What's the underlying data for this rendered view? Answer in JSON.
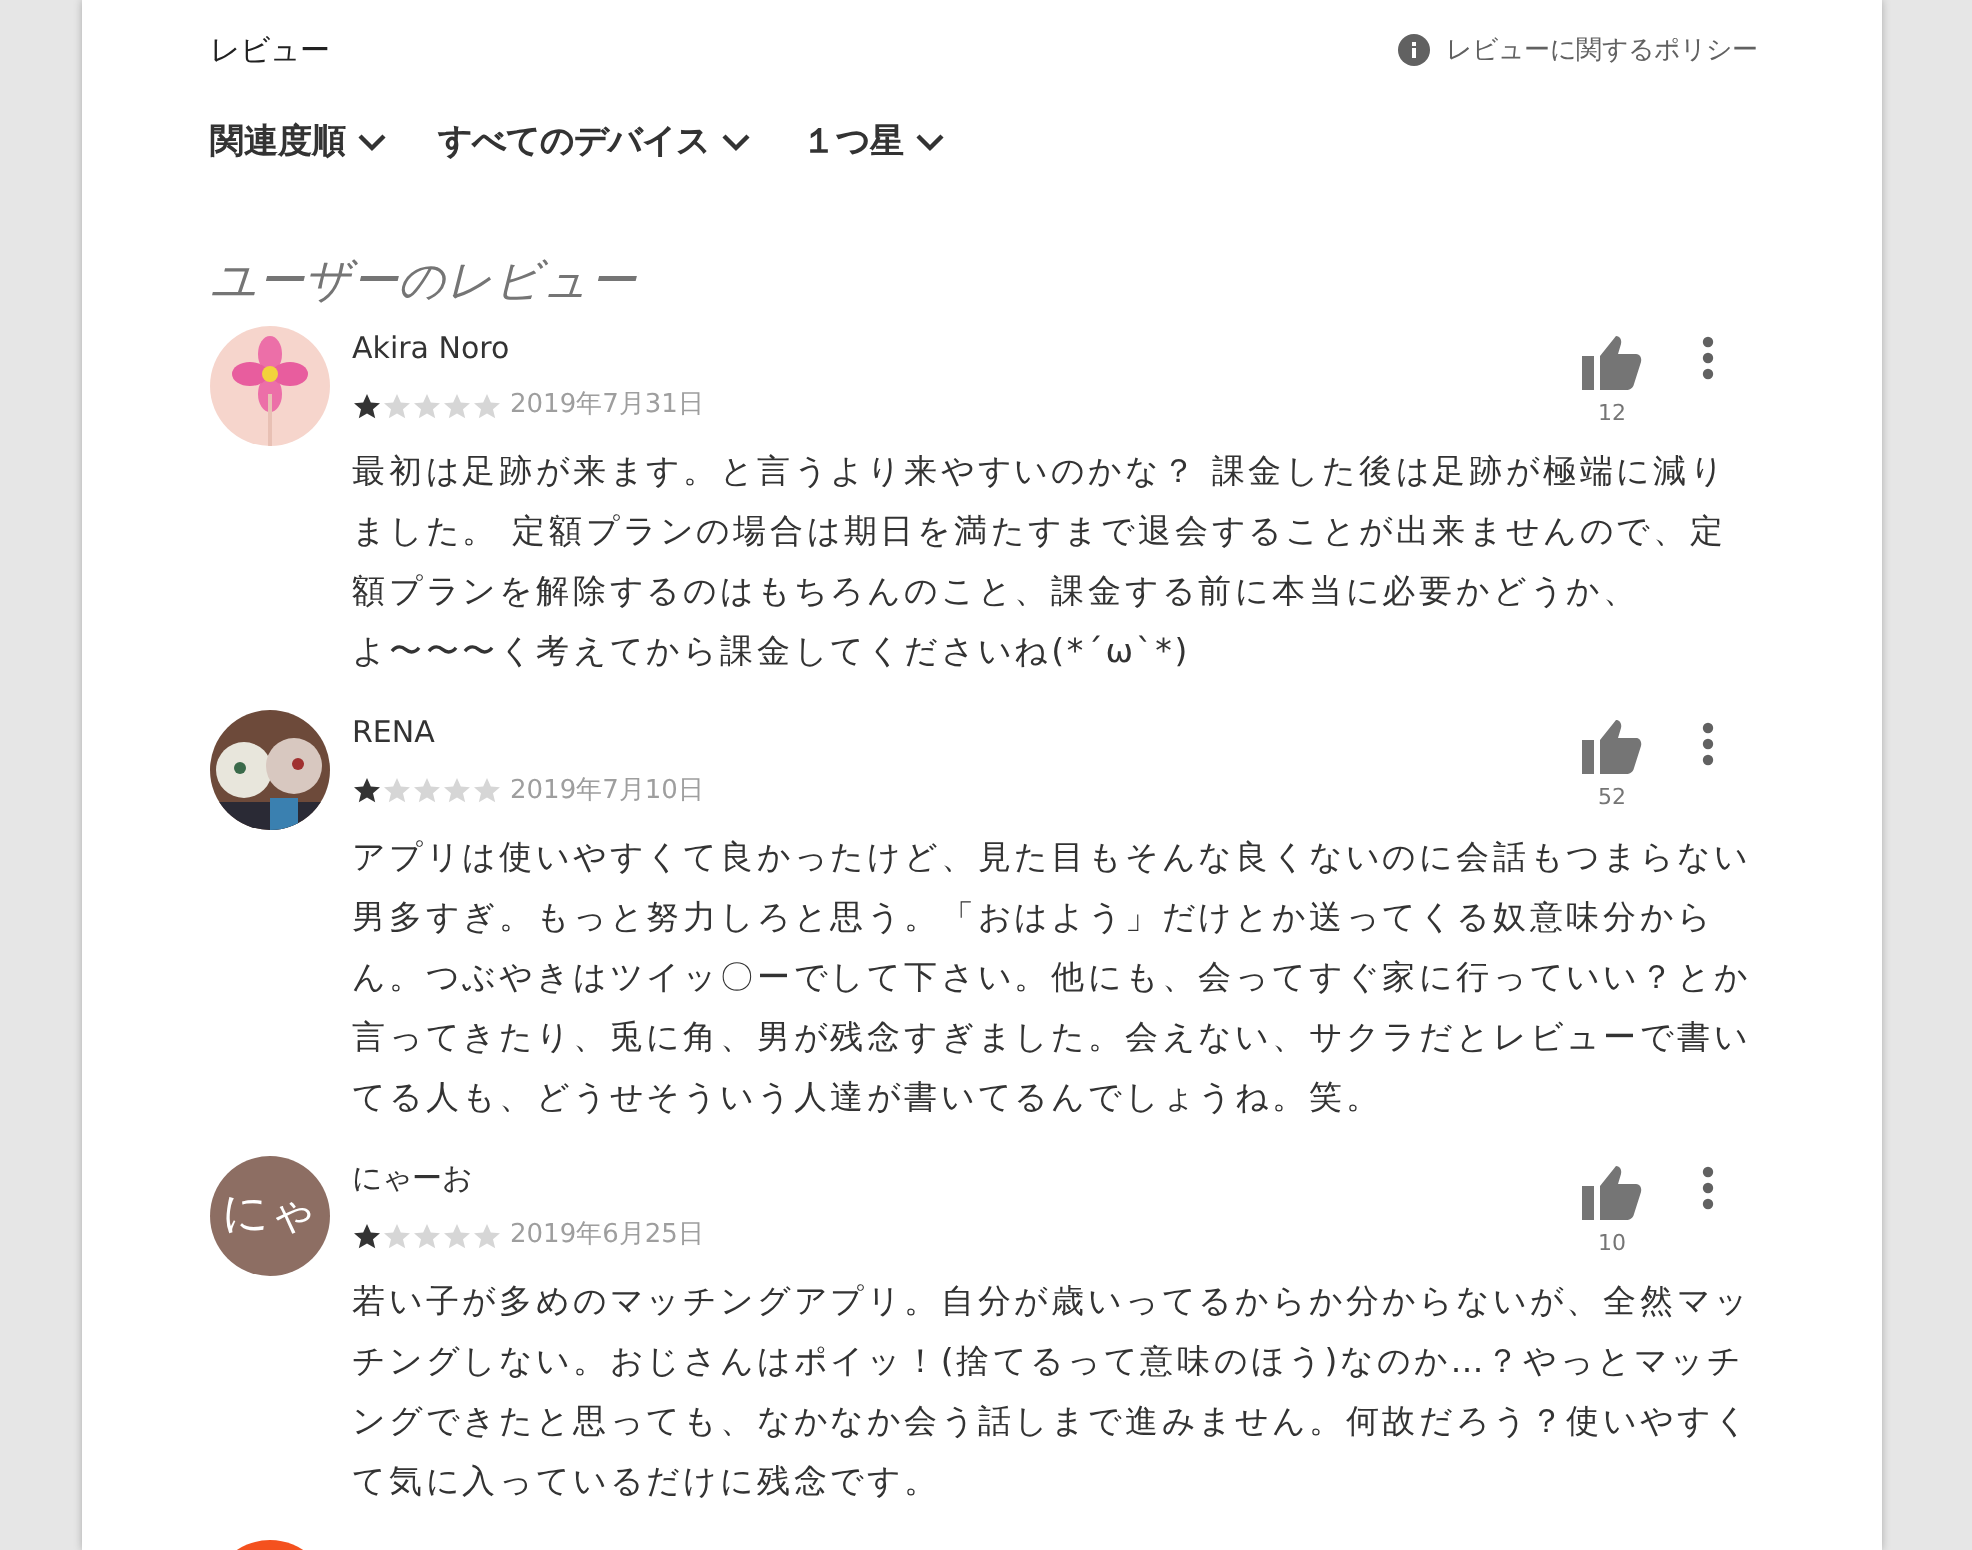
{
  "header": {
    "title": "レビュー",
    "policy_link": "レビューに関するポリシー"
  },
  "filters": [
    {
      "label": "関連度順"
    },
    {
      "label": "すべてのデバイス"
    },
    {
      "label": "１つ星"
    }
  ],
  "section_title": "ユーザーのレビュー",
  "reviews": [
    {
      "kind": "full",
      "name": "Akira Noro",
      "stars": 1,
      "date": "2019年7月31日",
      "likes": "12",
      "text": "最初は足跡が来ます。と言うより来やすいのかな？ 課金した後は足跡が極端に減りました。 定額プランの場合は期日を満たすまで退会することが出来ませんので、定額プランを解除するのはもちろんのこと、課金する前に本当に必要かどうか、よ〜〜〜く考えてから課金してくださいね(*´ω`*)"
    },
    {
      "kind": "full",
      "name": "RENA",
      "stars": 1,
      "date": "2019年7月10日",
      "likes": "52",
      "text": "アプリは使いやすくて良かったけど、見た目もそんな良くないのに会話もつまらない男多すぎ。もっと努力しろと思う。「おはよう」だけとか送ってくる奴意味分からん。つぶやきはツイッ〇ーでして下さい。他にも、会ってすぐ家に行っていい？とか言ってきたり、兎に角、男が残念すぎました。会えない、サクラだとレビューで書いてる人も、どうせそういう人達が書いてるんでしょうね。笑。"
    },
    {
      "kind": "full",
      "avatar": {
        "kind": "letters",
        "letters": "にゃ",
        "color": "#8d6e63"
      },
      "name": "にゃーお",
      "stars": 1,
      "date": "2019年6月25日",
      "likes": "10",
      "text": "若い子が多めのマッチングアプリ。自分が歳いってるからか分からないが、全然マッチングしない。おじさんはポイッ！(捨てるって意味のほう)なのか…？やっとマッチングできたと思っても、なかなか会う話しまで進みません。何故だろう？使いやすくて気に入っているだけに残念です。"
    },
    {
      "kind": "partial",
      "avatar": {
        "kind": "plain",
        "color": "#f4511e"
      }
    }
  ]
}
